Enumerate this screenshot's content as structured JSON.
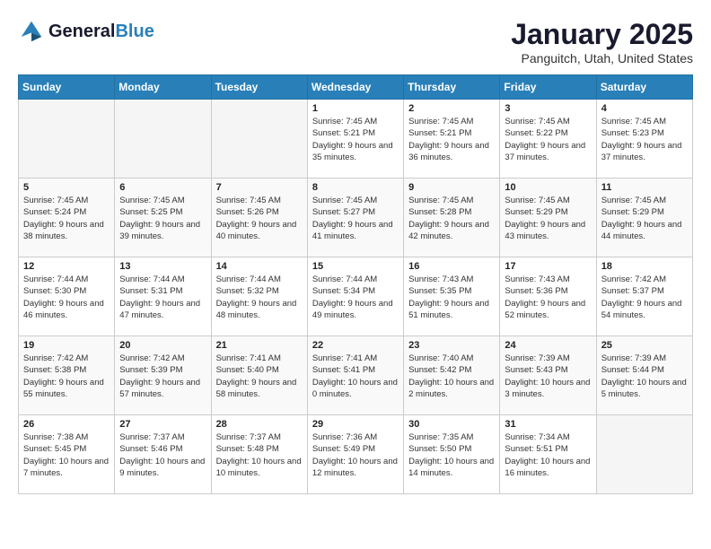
{
  "header": {
    "logo_general": "General",
    "logo_blue": "Blue",
    "title": "January 2025",
    "subtitle": "Panguitch, Utah, United States"
  },
  "days_of_week": [
    "Sunday",
    "Monday",
    "Tuesday",
    "Wednesday",
    "Thursday",
    "Friday",
    "Saturday"
  ],
  "weeks": [
    {
      "days": [
        {
          "number": "",
          "info": ""
        },
        {
          "number": "",
          "info": ""
        },
        {
          "number": "",
          "info": ""
        },
        {
          "number": "1",
          "info": "Sunrise: 7:45 AM\nSunset: 5:21 PM\nDaylight: 9 hours and 35 minutes."
        },
        {
          "number": "2",
          "info": "Sunrise: 7:45 AM\nSunset: 5:21 PM\nDaylight: 9 hours and 36 minutes."
        },
        {
          "number": "3",
          "info": "Sunrise: 7:45 AM\nSunset: 5:22 PM\nDaylight: 9 hours and 37 minutes."
        },
        {
          "number": "4",
          "info": "Sunrise: 7:45 AM\nSunset: 5:23 PM\nDaylight: 9 hours and 37 minutes."
        }
      ]
    },
    {
      "days": [
        {
          "number": "5",
          "info": "Sunrise: 7:45 AM\nSunset: 5:24 PM\nDaylight: 9 hours and 38 minutes."
        },
        {
          "number": "6",
          "info": "Sunrise: 7:45 AM\nSunset: 5:25 PM\nDaylight: 9 hours and 39 minutes."
        },
        {
          "number": "7",
          "info": "Sunrise: 7:45 AM\nSunset: 5:26 PM\nDaylight: 9 hours and 40 minutes."
        },
        {
          "number": "8",
          "info": "Sunrise: 7:45 AM\nSunset: 5:27 PM\nDaylight: 9 hours and 41 minutes."
        },
        {
          "number": "9",
          "info": "Sunrise: 7:45 AM\nSunset: 5:28 PM\nDaylight: 9 hours and 42 minutes."
        },
        {
          "number": "10",
          "info": "Sunrise: 7:45 AM\nSunset: 5:29 PM\nDaylight: 9 hours and 43 minutes."
        },
        {
          "number": "11",
          "info": "Sunrise: 7:45 AM\nSunset: 5:29 PM\nDaylight: 9 hours and 44 minutes."
        }
      ]
    },
    {
      "days": [
        {
          "number": "12",
          "info": "Sunrise: 7:44 AM\nSunset: 5:30 PM\nDaylight: 9 hours and 46 minutes."
        },
        {
          "number": "13",
          "info": "Sunrise: 7:44 AM\nSunset: 5:31 PM\nDaylight: 9 hours and 47 minutes."
        },
        {
          "number": "14",
          "info": "Sunrise: 7:44 AM\nSunset: 5:32 PM\nDaylight: 9 hours and 48 minutes."
        },
        {
          "number": "15",
          "info": "Sunrise: 7:44 AM\nSunset: 5:34 PM\nDaylight: 9 hours and 49 minutes."
        },
        {
          "number": "16",
          "info": "Sunrise: 7:43 AM\nSunset: 5:35 PM\nDaylight: 9 hours and 51 minutes."
        },
        {
          "number": "17",
          "info": "Sunrise: 7:43 AM\nSunset: 5:36 PM\nDaylight: 9 hours and 52 minutes."
        },
        {
          "number": "18",
          "info": "Sunrise: 7:42 AM\nSunset: 5:37 PM\nDaylight: 9 hours and 54 minutes."
        }
      ]
    },
    {
      "days": [
        {
          "number": "19",
          "info": "Sunrise: 7:42 AM\nSunset: 5:38 PM\nDaylight: 9 hours and 55 minutes."
        },
        {
          "number": "20",
          "info": "Sunrise: 7:42 AM\nSunset: 5:39 PM\nDaylight: 9 hours and 57 minutes."
        },
        {
          "number": "21",
          "info": "Sunrise: 7:41 AM\nSunset: 5:40 PM\nDaylight: 9 hours and 58 minutes."
        },
        {
          "number": "22",
          "info": "Sunrise: 7:41 AM\nSunset: 5:41 PM\nDaylight: 10 hours and 0 minutes."
        },
        {
          "number": "23",
          "info": "Sunrise: 7:40 AM\nSunset: 5:42 PM\nDaylight: 10 hours and 2 minutes."
        },
        {
          "number": "24",
          "info": "Sunrise: 7:39 AM\nSunset: 5:43 PM\nDaylight: 10 hours and 3 minutes."
        },
        {
          "number": "25",
          "info": "Sunrise: 7:39 AM\nSunset: 5:44 PM\nDaylight: 10 hours and 5 minutes."
        }
      ]
    },
    {
      "days": [
        {
          "number": "26",
          "info": "Sunrise: 7:38 AM\nSunset: 5:45 PM\nDaylight: 10 hours and 7 minutes."
        },
        {
          "number": "27",
          "info": "Sunrise: 7:37 AM\nSunset: 5:46 PM\nDaylight: 10 hours and 9 minutes."
        },
        {
          "number": "28",
          "info": "Sunrise: 7:37 AM\nSunset: 5:48 PM\nDaylight: 10 hours and 10 minutes."
        },
        {
          "number": "29",
          "info": "Sunrise: 7:36 AM\nSunset: 5:49 PM\nDaylight: 10 hours and 12 minutes."
        },
        {
          "number": "30",
          "info": "Sunrise: 7:35 AM\nSunset: 5:50 PM\nDaylight: 10 hours and 14 minutes."
        },
        {
          "number": "31",
          "info": "Sunrise: 7:34 AM\nSunset: 5:51 PM\nDaylight: 10 hours and 16 minutes."
        },
        {
          "number": "",
          "info": ""
        }
      ]
    }
  ]
}
